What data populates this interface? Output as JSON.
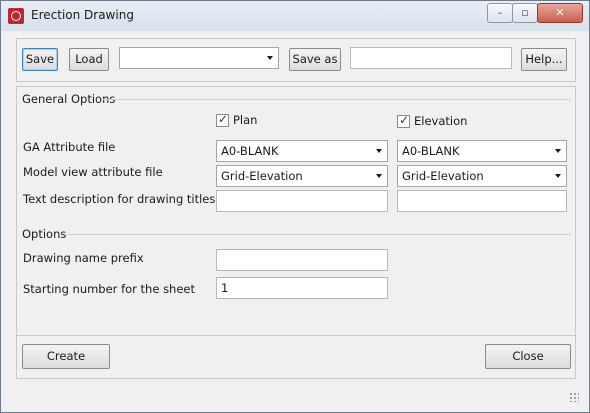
{
  "window": {
    "title": "Erection Drawing"
  },
  "toolbar": {
    "save_label": "Save",
    "load_label": "Load",
    "preset_value": "",
    "save_as_label": "Save as",
    "save_as_value": "",
    "help_label": "Help..."
  },
  "general": {
    "title": "General Options",
    "plan_label": "Plan",
    "elevation_label": "Elevation",
    "ga_label": "GA Attribute file",
    "model_label": "Model view attribute file",
    "desc_label": "Text description for drawing titles",
    "plan_ga_value": "A0-BLANK",
    "elev_ga_value": "A0-BLANK",
    "plan_model_value": "Grid-Elevation",
    "elev_model_value": "Grid-Elevation",
    "plan_desc_value": "",
    "elev_desc_value": ""
  },
  "options": {
    "title": "Options",
    "prefix_label": "Drawing name prefix",
    "prefix_value": "",
    "start_label": "Starting number for the sheet",
    "start_value": "1"
  },
  "footer": {
    "create_label": "Create",
    "close_label": "Close"
  },
  "icons": [
    "app-icon",
    "minimize-icon",
    "maximize-icon",
    "close-icon",
    "dropdown-arrow-icon",
    "checkbox-check-icon",
    "resize-grip-icon"
  ]
}
